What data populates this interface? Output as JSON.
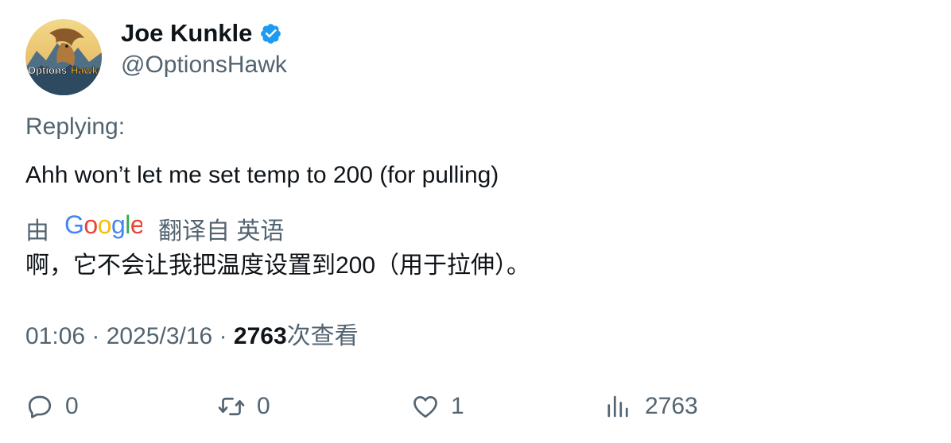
{
  "author": {
    "display_name": "Joe Kunkle",
    "handle": "@OptionsHawk",
    "avatar_label": "OptionsHawk",
    "verified": true,
    "verified_color": "#1d9bf0"
  },
  "tweet": {
    "replying_label": "Replying:",
    "text": "Ahh won’t let me set temp to 200 (for pulling)"
  },
  "translation": {
    "prefix": "由",
    "provider": "Google",
    "suffix": "翻译自 英语",
    "text": "啊，它不会让我把温度设置到200（用于拉伸）。"
  },
  "meta": {
    "time": "01:06",
    "separator": "·",
    "date": "2025/3/16",
    "views_count": "2763",
    "views_label": "次查看"
  },
  "actions": {
    "reply_count": "0",
    "retweet_count": "0",
    "like_count": "1",
    "views_count": "2763"
  },
  "icons": {
    "reply": "comment-bubble-icon",
    "retweet": "retweet-arrows-icon",
    "like": "heart-icon",
    "views": "bar-chart-icon",
    "verified": "verified-badge-icon"
  },
  "colors": {
    "primary_text": "#0f1419",
    "secondary_text": "#536471",
    "google_blue": "#4285F4",
    "google_red": "#EA4335",
    "google_yellow": "#FBBC05",
    "google_green": "#34A853"
  }
}
